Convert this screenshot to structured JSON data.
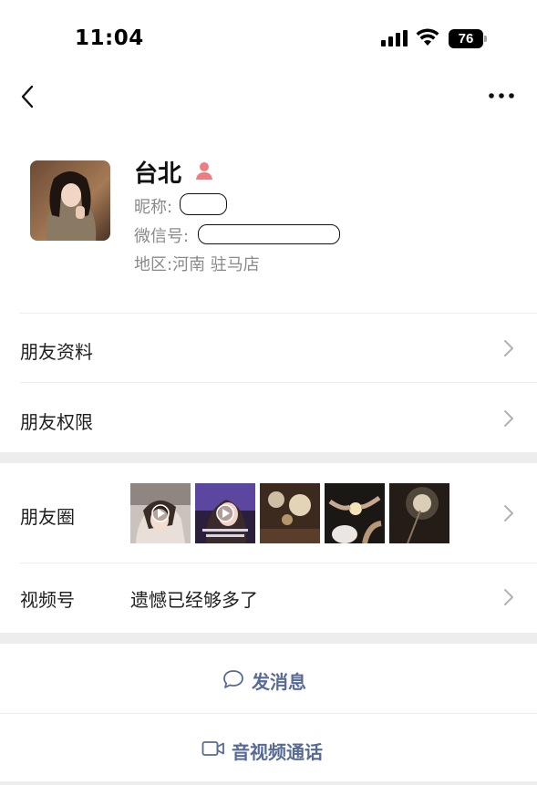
{
  "status_bar": {
    "time": "11:04",
    "battery": "76"
  },
  "nav": {
    "back_icon": "chevron-left-icon",
    "more_icon": "ellipsis-icon"
  },
  "profile": {
    "name": "台北",
    "gender_icon": "female-person-icon",
    "gender_color": "#f07c82",
    "nickname_label": "昵称:",
    "wechat_id_label": "微信号:",
    "region_label": "地区:",
    "region_value": "河南 驻马店"
  },
  "menu": {
    "friend_info": "朋友资料",
    "friend_permissions": "朋友权限",
    "moments": "朋友圈",
    "channels": "视频号",
    "channels_value": "遗憾已经够多了"
  },
  "actions": {
    "send_message": "发消息",
    "message_icon": "chat-bubble-icon",
    "video_call": "音视频通话",
    "video_icon": "video-camera-icon",
    "accent_color": "#576b95"
  }
}
